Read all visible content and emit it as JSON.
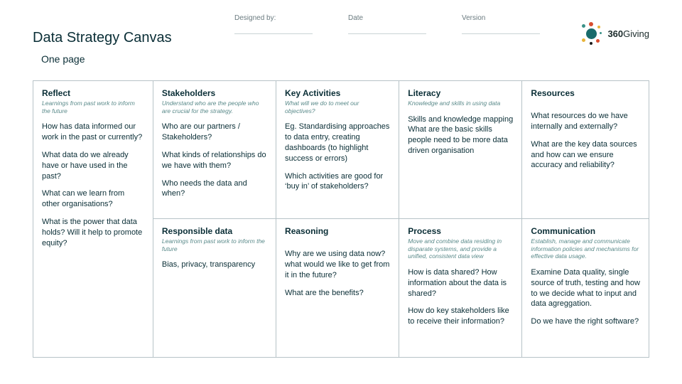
{
  "meta": {
    "designed_by_label": "Designed by:",
    "date_label": "Date",
    "version_label": "Version"
  },
  "title": {
    "t1": "Data",
    "t2": "Strategy",
    "t3": "Canvas"
  },
  "subtitle": "One page",
  "logo": {
    "text_bold": "360",
    "text_rest": "Giving"
  },
  "cells": {
    "reflect": {
      "title": "Reflect",
      "sub": "Learnings from past work to inform the future",
      "p1": "How has data informed our work in the past or currently?",
      "p2": "What data do we already have or have used in the past?",
      "p3": "What can we learn from other organisations?",
      "p4": "What is the power that data holds? Will it help to promote equity?"
    },
    "stakeholders": {
      "title": "Stakeholders",
      "sub": "Understand who are the people who are crucial for the strategy.",
      "p1": "Who are our partners / Stakeholders?",
      "p2": "What kinds of relationships do we have with them?",
      "p3": "Who needs the data and when?"
    },
    "key_activities": {
      "title": "Key Activities",
      "sub": "What will we do to meet our objectives?",
      "p1": "Eg. Standardising approaches to data entry, creating dashboards (to highlight success or errors)",
      "p2": "Which activities are good for ‘buy in’ of stakeholders?"
    },
    "literacy": {
      "title": "Literacy",
      "sub": "Knowledge and skills in using data",
      "p1": "Skills and knowledge mapping What are the basic skills people need to be more data driven organisation"
    },
    "resources": {
      "title": "Resources",
      "sub": "",
      "p1": "What resources do we have  internally and externally?",
      "p2": "What are the key data sources and how can we ensure accuracy and reliability?"
    },
    "responsible": {
      "title": "Responsible data",
      "sub": "Learnings from past work to inform the future",
      "p1": "Bias, privacy, transparency"
    },
    "reasoning": {
      "title": "Reasoning",
      "sub": "",
      "p1": "Why are we using data now? what would we like to get from it in the future?",
      "p2": "What are the benefits?"
    },
    "process": {
      "title": "Process",
      "sub": "Move and combine data  residing in disparate systems,  and provide a unified, consistent data view",
      "p1": "How is data shared? How information about the data is shared?",
      "p2": "How do key stakeholders like to receive their information?"
    },
    "communication": {
      "title": "Communication",
      "sub": "Establish, manage and communicate information policies and mechanisms for effective data usage.",
      "p1": "Examine Data quality, single source of truth, testing and how to we decide what to input and data agreggation.",
      "p2": "Do we have the right software?"
    }
  }
}
